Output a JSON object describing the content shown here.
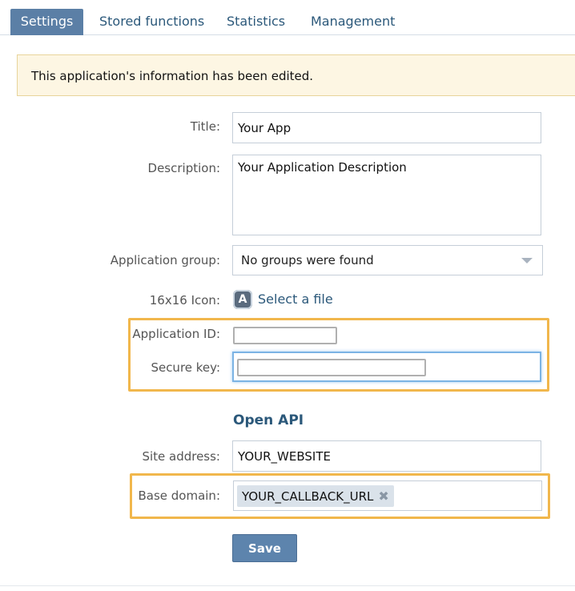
{
  "tabs": [
    {
      "label": "Settings",
      "active": true
    },
    {
      "label": "Stored functions",
      "active": false
    },
    {
      "label": "Statistics",
      "active": false
    },
    {
      "label": "Management",
      "active": false
    }
  ],
  "notice": "This application's information has been edited.",
  "form": {
    "title_label": "Title:",
    "title_value": "Your App",
    "description_label": "Description:",
    "description_value": "Your Application Description",
    "group_label": "Application group:",
    "group_value": "No groups were found",
    "icon_label": "16x16 Icon:",
    "icon_letter": "A",
    "select_file": "Select a file",
    "app_id_label": "Application ID:",
    "secure_key_label": "Secure key:"
  },
  "open_api": {
    "heading": "Open API",
    "site_label": "Site address:",
    "site_value": "YOUR_WEBSITE",
    "domain_label": "Base domain:",
    "domain_chip": "YOUR_CALLBACK_URL",
    "remove_glyph": "✖"
  },
  "save_label": "Save",
  "colors": {
    "accent": "#5b7fa6",
    "link": "#2b587a",
    "highlight": "#f1b74c",
    "notice_bg": "#fdf6e3"
  }
}
